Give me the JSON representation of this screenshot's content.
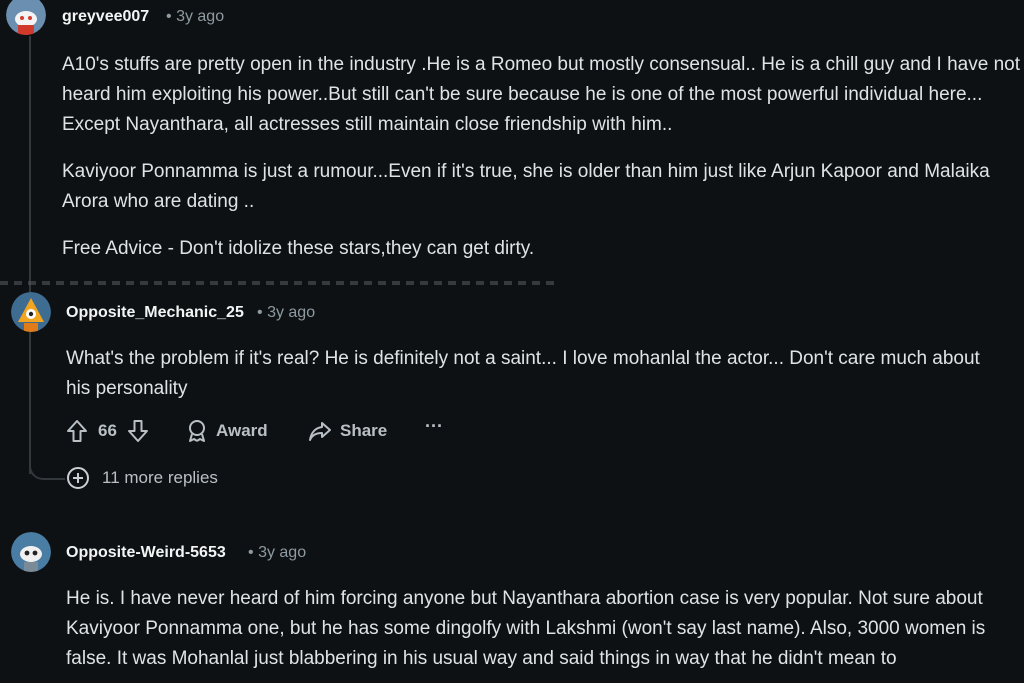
{
  "comments": [
    {
      "username": "greyvee007",
      "age": "3y ago",
      "paragraphs": [
        "A10's stuffs are pretty open in the industry .He is a Romeo but mostly consensual.. He is a chill guy and I have not heard him exploiting his power..But still can't be sure because he is one of the most powerful individual here... Except Nayanthara, all actresses still maintain close friendship with him..",
        "Kaviyoor Ponnamma is just a rumour...Even if it's true, she is older than him just like Arjun Kapoor and Malaika Arora who are dating ..",
        "Free Advice - Don't idolize these stars,they can get dirty."
      ]
    },
    {
      "username": "Opposite_Mechanic_25",
      "age": "3y ago",
      "paragraphs": [
        "What's the problem if it's real? He is definitely not a saint... I love mohanlal the actor... Don't care much about his personality"
      ],
      "votes": "66",
      "award_label": "Award",
      "share_label": "Share",
      "more_label": "···"
    },
    {
      "username": "Opposite-Weird-5653",
      "age": "3y ago",
      "paragraphs": [
        "He is. I have never heard of him forcing anyone but Nayanthara abortion case is very popular. Not sure about Kaviyoor Ponnamma one, but he has some dingolfy with Lakshmi (won't say last name). Also, 3000 women is false. It was Mohanlal just blabbering in his usual way and said things in way that he didn't mean to"
      ]
    }
  ],
  "more_replies": "11 more replies",
  "separator": "•",
  "icons": {
    "upvote": "upvote-arrow-icon",
    "downvote": "downvote-arrow-icon",
    "award": "award-icon",
    "share": "share-icon",
    "expand": "plus-circle-icon"
  },
  "colors": {
    "background": "#0e1113",
    "text": "#dfe3e6",
    "muted": "#8e9aa1",
    "thread_line": "#33383c"
  }
}
